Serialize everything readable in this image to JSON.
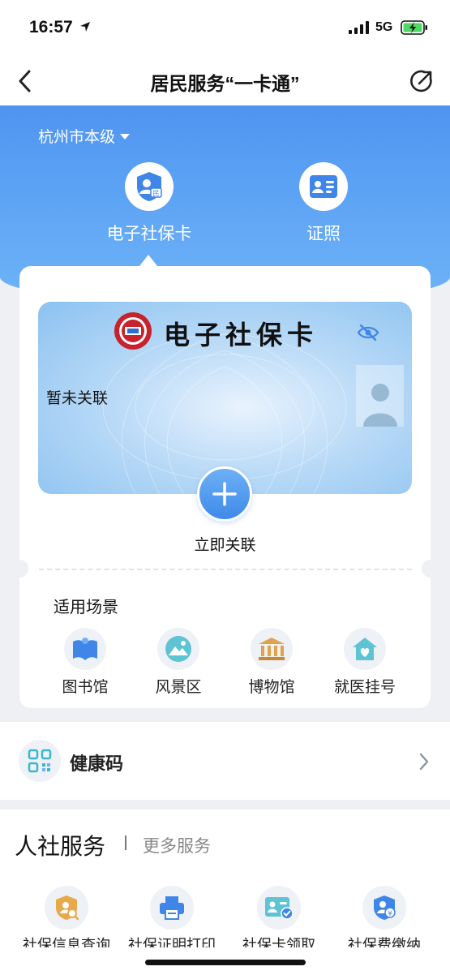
{
  "status_bar": {
    "time": "16:57",
    "network": "5G"
  },
  "nav": {
    "title": "居民服务“一卡通”"
  },
  "region": {
    "label": "杭州市本级"
  },
  "top_tabs": [
    {
      "label": "电子社保卡",
      "icon": "shield-card-icon",
      "active": true
    },
    {
      "label": "证照",
      "icon": "id-card-icon",
      "active": false
    }
  ],
  "card": {
    "title": "电子社保卡",
    "status": "暂未关联",
    "action_label": "立即关联"
  },
  "scenes": {
    "title": "适用场景",
    "items": [
      {
        "label": "图书馆",
        "icon": "book-icon"
      },
      {
        "label": "风景区",
        "icon": "mountain-icon"
      },
      {
        "label": "博物馆",
        "icon": "museum-icon"
      },
      {
        "label": "就医挂号",
        "icon": "hospital-icon"
      }
    ]
  },
  "health_code": {
    "label": "健康码"
  },
  "services": {
    "title": "人社服务",
    "more": "更多服务",
    "items": [
      {
        "label": "社保信息查询",
        "icon": "search-doc-icon"
      },
      {
        "label": "社保证明打印",
        "icon": "printer-icon"
      },
      {
        "label": "社保卡领取",
        "icon": "card-check-icon"
      },
      {
        "label": "社保费缴纳",
        "icon": "yuan-shield-icon"
      }
    ]
  },
  "colors": {
    "primary": "#4f95f1",
    "accent_orange": "#e8a94a",
    "background": "#eef0f4"
  }
}
